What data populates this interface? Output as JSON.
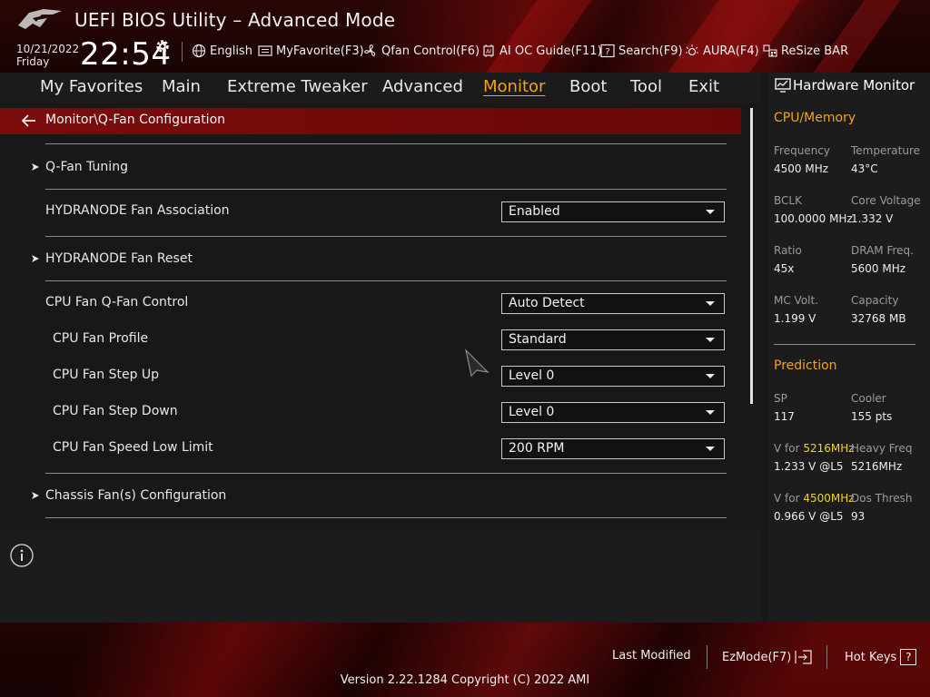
{
  "header": {
    "title": "UEFI BIOS Utility – Advanced Mode",
    "date": "10/21/2022",
    "day": "Friday",
    "time": "22:54",
    "tools": [
      {
        "label": "English",
        "icon": "globe-icon"
      },
      {
        "label": "MyFavorite(F3)",
        "icon": "favorite-list-icon"
      },
      {
        "label": "Qfan Control(F6)",
        "icon": "fan-icon"
      },
      {
        "label": "AI OC Guide(F11)",
        "icon": "ai-chip-icon"
      },
      {
        "label": "Search(F9)",
        "icon": "search-help-icon"
      },
      {
        "label": "AURA(F4)",
        "icon": "aura-light-icon"
      },
      {
        "label": "ReSize BAR",
        "icon": "resize-bar-icon"
      }
    ]
  },
  "nav": {
    "tabs": [
      "My Favorites",
      "Main",
      "Extreme Tweaker",
      "Advanced",
      "Monitor",
      "Boot",
      "Tool",
      "Exit"
    ],
    "active": "Monitor"
  },
  "content": {
    "breadcrumb": "Monitor\\Q-Fan Configuration",
    "items": [
      {
        "label": "Q-Fan Tuning",
        "type": "submenu"
      },
      {
        "label": "HYDRANODE Fan Association",
        "type": "dropdown",
        "value": "Enabled"
      },
      {
        "label": "HYDRANODE Fan Reset",
        "type": "submenu"
      },
      {
        "label": "CPU Fan Q-Fan Control",
        "type": "dropdown",
        "value": "Auto Detect"
      },
      {
        "label": "CPU Fan Profile",
        "type": "dropdown",
        "value": "Standard"
      },
      {
        "label": "CPU Fan Step Up",
        "type": "dropdown",
        "value": "Level 0"
      },
      {
        "label": "CPU Fan Step Down",
        "type": "dropdown",
        "value": "Level 0"
      },
      {
        "label": "CPU Fan Speed Low Limit",
        "type": "dropdown",
        "value": "200 RPM"
      },
      {
        "label": "Chassis Fan(s) Configuration",
        "type": "submenu"
      }
    ]
  },
  "hw_monitor": {
    "title": "Hardware Monitor",
    "cpu_memory": {
      "heading": "CPU/Memory",
      "fields": [
        {
          "label": "Frequency",
          "value": "4500 MHz"
        },
        {
          "label": "Temperature",
          "value": "43°C"
        },
        {
          "label": "BCLK",
          "value": "100.0000 MHz"
        },
        {
          "label": "Core Voltage",
          "value": "1.332 V"
        },
        {
          "label": "Ratio",
          "value": "45x"
        },
        {
          "label": "DRAM Freq.",
          "value": "5600 MHz"
        },
        {
          "label": "MC Volt.",
          "value": "1.199 V"
        },
        {
          "label": "Capacity",
          "value": "32768 MB"
        }
      ]
    },
    "prediction": {
      "heading": "Prediction",
      "sp_label": "SP",
      "sp_value": "117",
      "cooler_label": "Cooler",
      "cooler_value": "155 pts",
      "v1_prefix": "V for ",
      "v1_freq": "5216MHz",
      "v1_value": "1.233 V @L5",
      "heavy_label": "Heavy Freq",
      "heavy_value": "5216MHz",
      "v2_prefix": "V for ",
      "v2_freq": "4500MHz",
      "v2_value": "0.966 V @L5",
      "dos_label": "Dos Thresh",
      "dos_value": "93"
    }
  },
  "footer": {
    "last_modified": "Last Modified",
    "ezmode": "EzMode(F7)",
    "hot_keys": "Hot Keys",
    "hot_keys_key": "?",
    "version": "Version 2.22.1284 Copyright (C) 2022 AMI"
  },
  "colors": {
    "accent": "#f2a31c",
    "highlight": "#f5d21e",
    "breadcrumb_bar": "#7a0c0c"
  }
}
